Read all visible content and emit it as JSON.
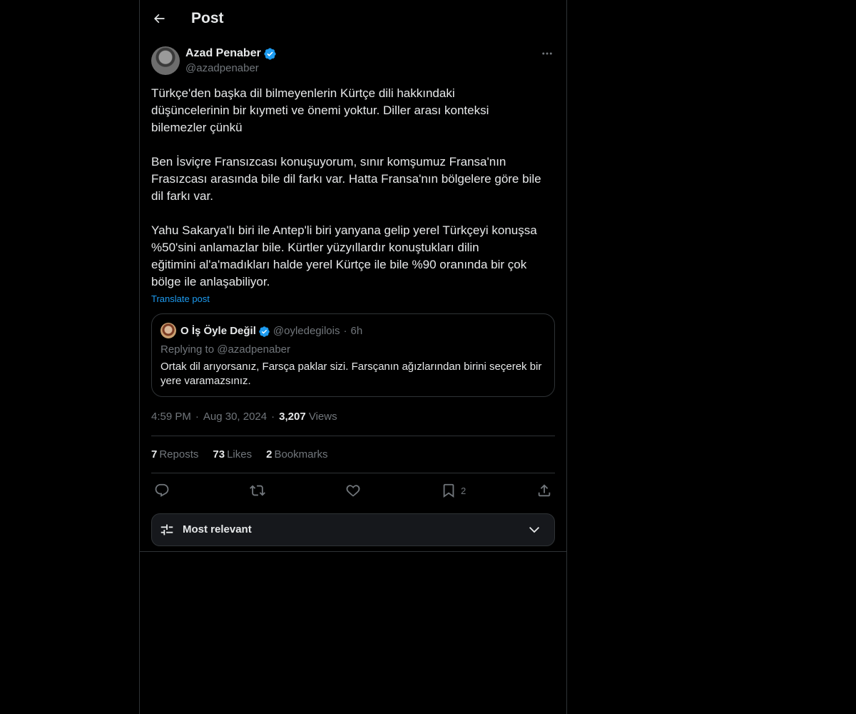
{
  "header": {
    "title": "Post"
  },
  "post": {
    "author": {
      "name": "Azad Penaber",
      "handle": "@azadpenaber",
      "verified": true
    },
    "paragraphs": [
      "Türkçe'den başka dil bilmeyenlerin Kürtçe dili hakkındaki\ndüşüncelerinin bir kıymeti ve önemi yoktur. Diller arası konteksi\nbilemezler çünkü",
      "Ben İsviçre Fransızcası konuşuyorum, sınır komşumuz Fransa'nın\nFrasızcası arasında bile dil farkı var. Hatta Fransa'nın bölgelere göre bile\ndil farkı var.",
      "Yahu Sakarya'lı biri ile Antep'li biri yanyana gelip yerel Türkçeyi konuşsa\n%50'sini anlamazlar bile. Kürtler yüzyıllardır konuştukları dilin\neğitimini al'a'madıkları halde yerel Kürtçe ile bile %90 oranında bir çok\nbölge ile anlaşabiliyor."
    ],
    "translate_label": "Translate post",
    "quote": {
      "name": "O İş Öyle Değil",
      "handle": "@oyledegilois",
      "separator": "·",
      "time": "6h",
      "replying_to": "Replying to @azadpenaber",
      "text": "Ortak dil arıyorsanız, Farsça paklar sizi. Farsçanın ağızlarından birini seçerek bir yere varamazsınız."
    },
    "meta": {
      "time": "4:59 PM",
      "separator": "·",
      "date": "Aug 30, 2024",
      "views_count": "3,207",
      "views_label": "Views"
    },
    "stats": {
      "reposts_count": "7",
      "reposts_label": "Reposts",
      "likes_count": "73",
      "likes_label": "Likes",
      "bookmarks_count": "2",
      "bookmarks_label": "Bookmarks"
    },
    "actions": {
      "reply_icon": "reply-icon",
      "repost_icon": "repost-icon",
      "like_icon": "like-icon",
      "bookmark_icon": "bookmark-icon",
      "bookmark_count": "2",
      "share_icon": "share-icon"
    }
  },
  "sort": {
    "label": "Most relevant",
    "icon": "sliders-icon",
    "chevron": "chevron-down-icon"
  },
  "colors": {
    "background": "#000000",
    "text": "#e7e9ea",
    "muted": "#71767b",
    "accent": "#1d9bf0",
    "border": "#2f3336"
  }
}
